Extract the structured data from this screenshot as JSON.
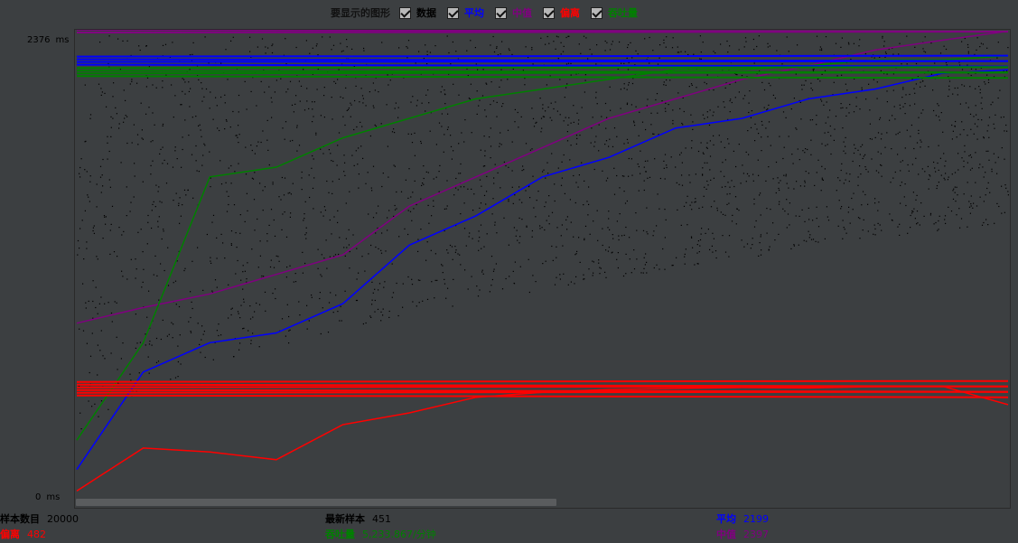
{
  "legend": {
    "title": "要显示的图形",
    "items": [
      {
        "key": "data",
        "label": "数据",
        "color": "#000000",
        "checked": true
      },
      {
        "key": "avg",
        "label": "平均",
        "color": "#0000ff",
        "checked": true
      },
      {
        "key": "median",
        "label": "中值",
        "color": "#800080",
        "checked": true
      },
      {
        "key": "deviation",
        "label": "偏离",
        "color": "#ff0000",
        "checked": true
      },
      {
        "key": "throughput",
        "label": "吞吐量",
        "color": "#008000",
        "checked": true
      }
    ]
  },
  "axis": {
    "y_max_value": "2376",
    "y_min_value": "0",
    "unit": "ms"
  },
  "stats": {
    "sample_count": {
      "label": "样本数目",
      "value": "20000",
      "color": "#000000"
    },
    "deviation": {
      "label": "偏离",
      "value": "482",
      "color": "#ff0000"
    },
    "latest_sample": {
      "label": "最新样本",
      "value": "451",
      "color": "#000000"
    },
    "throughput": {
      "label": "吞吐量",
      "value": "5,233.867/分钟",
      "color": "#008000"
    },
    "average": {
      "label": "平均",
      "value": "2199",
      "color": "#0000ff"
    },
    "median": {
      "label": "中值",
      "value": "2397",
      "color": "#800080"
    }
  },
  "chart_data": {
    "type": "line",
    "ylim": [
      0,
      2376
    ],
    "ylabel": "ms",
    "series": [
      {
        "name": "平均",
        "color": "#0000ff",
        "y": [
          150,
          650,
          800,
          850,
          1000,
          1300,
          1450,
          1650,
          1750,
          1900,
          1950,
          2050,
          2100,
          2180,
          2199
        ]
      },
      {
        "name": "中值",
        "color": "#800080",
        "y": [
          900,
          980,
          1050,
          1150,
          1250,
          1500,
          1650,
          1800,
          1950,
          2050,
          2150,
          2220,
          2300,
          2350,
          2397
        ]
      },
      {
        "name": "偏离",
        "color": "#ff0000",
        "y": [
          40,
          260,
          240,
          200,
          380,
          440,
          520,
          545,
          560,
          565,
          570,
          568,
          575,
          578,
          482
        ]
      },
      {
        "name": "吞吐量",
        "color": "#008000",
        "y": [
          300,
          800,
          1650,
          1700,
          1850,
          1950,
          2050,
          2100,
          2150,
          2200,
          2200,
          2220,
          2250,
          2250,
          2270
        ]
      }
    ]
  }
}
